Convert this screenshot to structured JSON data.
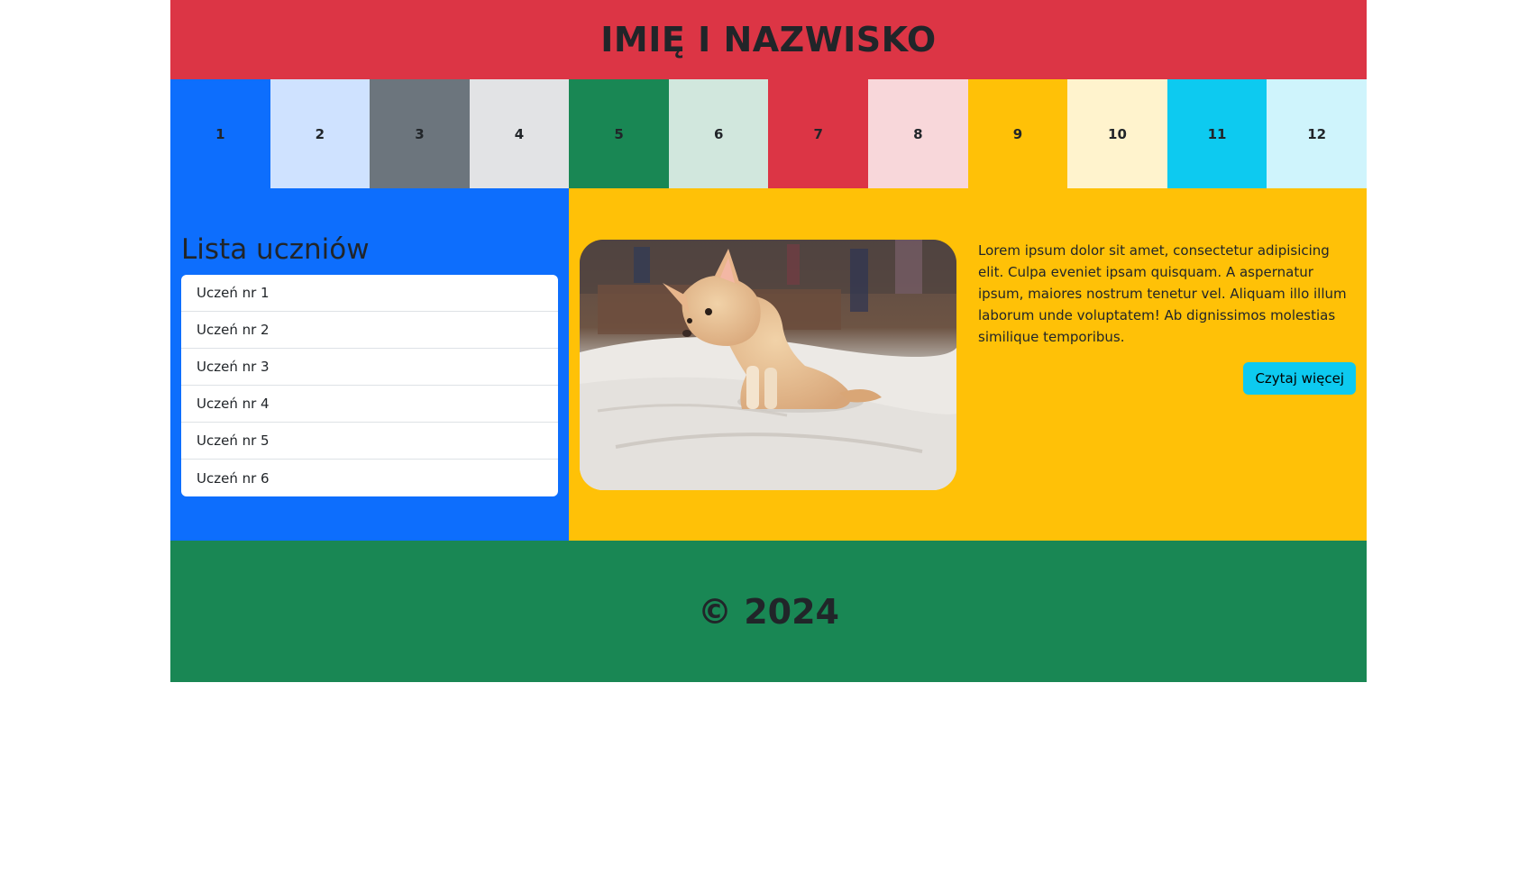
{
  "header": {
    "title": "IMIĘ I NAZWISKO",
    "color": "#dc3545"
  },
  "color_row": [
    {
      "label": "1",
      "color": "#0d6efd"
    },
    {
      "label": "2",
      "color": "#cfe2ff"
    },
    {
      "label": "3",
      "color": "#6c757d"
    },
    {
      "label": "4",
      "color": "#e2e3e5"
    },
    {
      "label": "5",
      "color": "#198754"
    },
    {
      "label": "6",
      "color": "#d1e7dd"
    },
    {
      "label": "7",
      "color": "#dc3545"
    },
    {
      "label": "8",
      "color": "#f8d7da"
    },
    {
      "label": "9",
      "color": "#ffc107"
    },
    {
      "label": "10",
      "color": "#fff3cd"
    },
    {
      "label": "11",
      "color": "#0dcaf0"
    },
    {
      "label": "12",
      "color": "#cff4fc"
    }
  ],
  "students": {
    "heading": "Lista uczniów",
    "items": [
      "Uczeń nr 1",
      "Uczeń nr 2",
      "Uczeń nr 3",
      "Uczeń nr 4",
      "Uczeń nr 5",
      "Uczeń nr 6"
    ]
  },
  "article": {
    "image_subject": "chihuahua-puppy-on-bed",
    "text": "Lorem ipsum dolor sit amet, consectetur adipisicing elit. Culpa eveniet ipsam quisquam. A aspernatur ipsum, maiores nostrum tenetur vel. Aliquam illo illum laborum unde voluptatem! Ab dignissimos molestias similique temporibus.",
    "button_label": "Czytaj więcej"
  },
  "footer": {
    "text": "© 2024",
    "color": "#198754"
  }
}
